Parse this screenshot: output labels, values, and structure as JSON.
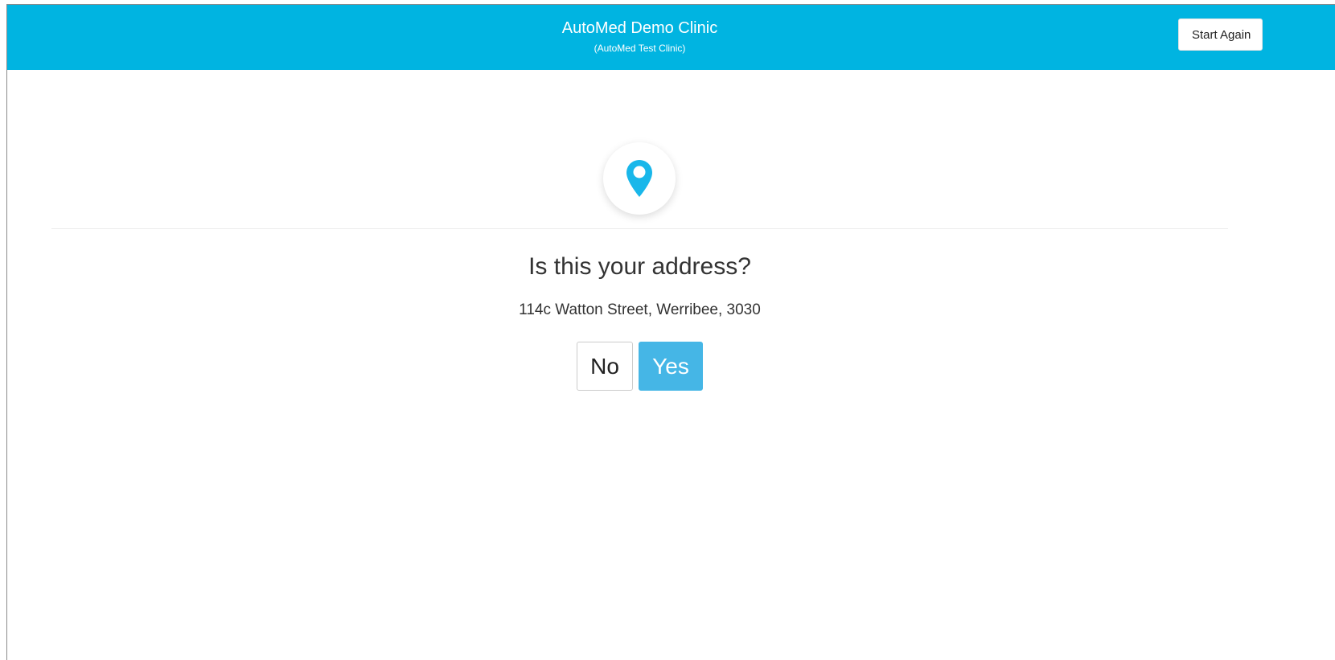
{
  "header": {
    "clinic_name": "AutoMed Demo Clinic",
    "clinic_subtitle": "(AutoMed Test Clinic)",
    "start_again_label": "Start Again",
    "background_color": "#00b4e1"
  },
  "main": {
    "icon": "map-pin-icon",
    "icon_color": "#19b7ea",
    "question": "Is this your address?",
    "address": "114c Watton Street, Werribee, 3030",
    "no_label": "No",
    "yes_label": "Yes",
    "yes_color": "#45b6e6"
  }
}
